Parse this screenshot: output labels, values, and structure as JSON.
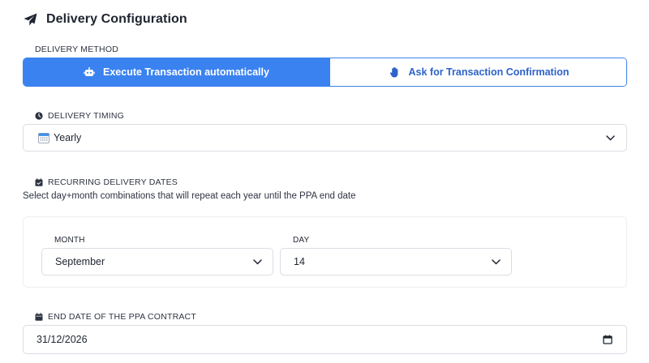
{
  "header": {
    "title": "Delivery Configuration",
    "icon": "paper-plane-icon"
  },
  "delivery_method": {
    "label": "DELIVERY METHOD",
    "options": [
      {
        "label": "Execute Transaction automatically",
        "icon": "robot-icon",
        "selected": true
      },
      {
        "label": "Ask for Transaction Confirmation",
        "icon": "hand-icon",
        "selected": false
      }
    ]
  },
  "delivery_timing": {
    "label": "DELIVERY TIMING",
    "icon": "clock-icon",
    "selected": "Yearly",
    "selected_icon": "calendar-emoji-icon"
  },
  "recurring": {
    "label": "RECURRING DELIVERY DATES",
    "icon": "calendar-check-icon",
    "helper": "Select day+month combinations that will repeat each year until the PPA end date",
    "month_label": "MONTH",
    "month_value": "September",
    "day_label": "DAY",
    "day_value": "14"
  },
  "end_date": {
    "label": "END DATE OF THE PPA CONTRACT",
    "icon": "calendar-icon",
    "value": "31/12/2026"
  },
  "colors": {
    "accent": "#3a82f0",
    "accent_text": "#2d62c8",
    "border": "#d9dde3",
    "text": "#1f2430"
  }
}
